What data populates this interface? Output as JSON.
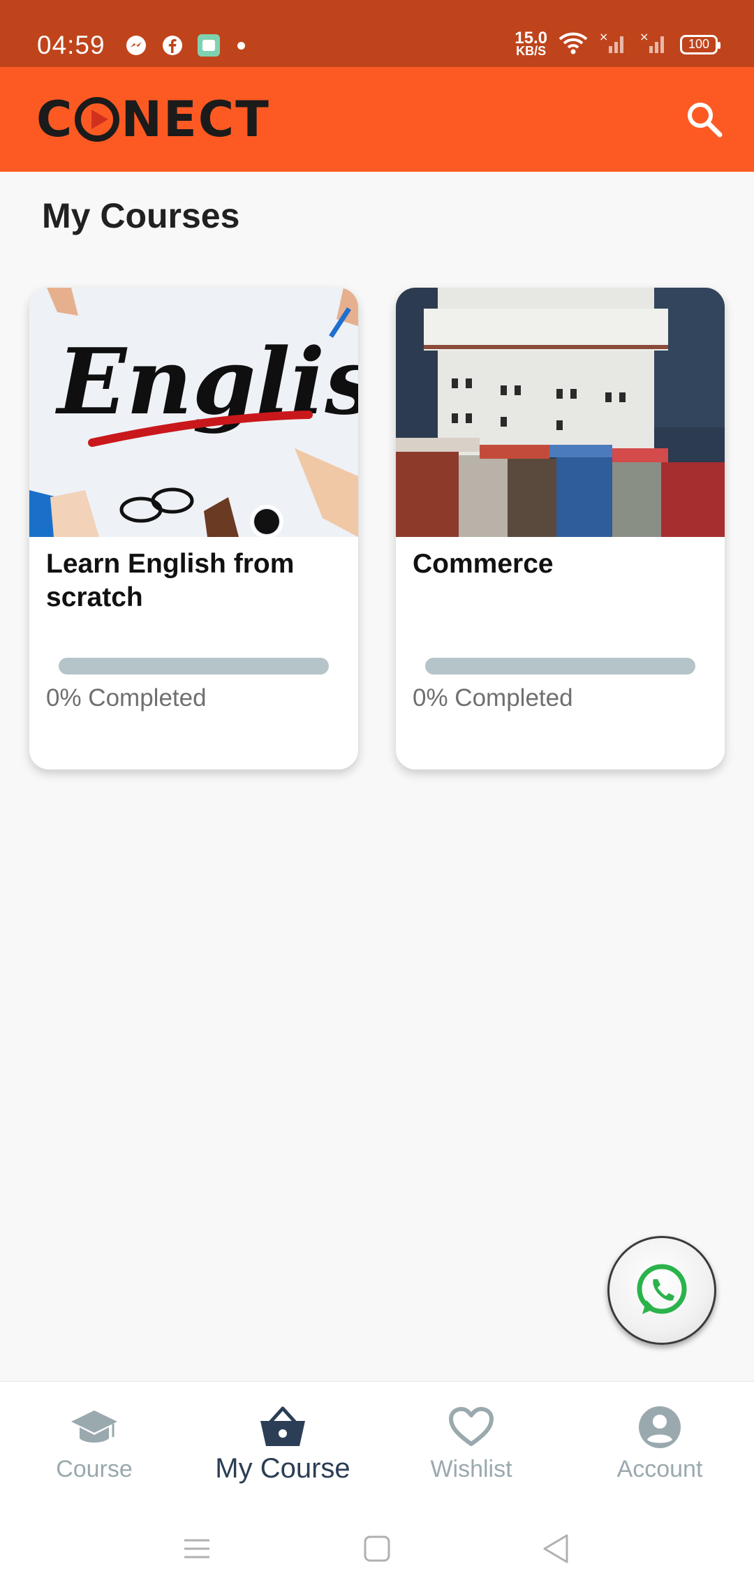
{
  "status_bar": {
    "time": "04:59",
    "net_speed_value": "15.0",
    "net_speed_unit": "KB/S",
    "battery": "100",
    "icons": [
      "messenger-icon",
      "facebook-icon",
      "app-icon",
      "wifi-icon",
      "signal-icon",
      "signal-icon",
      "battery-icon"
    ]
  },
  "app_bar": {
    "logo_parts": [
      "C",
      "NECT"
    ],
    "search_icon": "search-icon"
  },
  "page": {
    "title": "My Courses"
  },
  "courses": [
    {
      "title": "Learn English from scratch",
      "progress": 0,
      "progress_label": "0% Completed"
    },
    {
      "title": "Commerce",
      "progress": 0,
      "progress_label": "0% Completed"
    }
  ],
  "fab": {
    "icon": "whatsapp-icon"
  },
  "bottom_nav": {
    "items": [
      {
        "label": "Course",
        "icon": "graduation-cap-icon"
      },
      {
        "label": "My Course",
        "icon": "basket-icon",
        "active": true
      },
      {
        "label": "Wishlist",
        "icon": "heart-icon"
      },
      {
        "label": "Account",
        "icon": "account-icon"
      }
    ]
  },
  "colors": {
    "status_bar": "#bf441c",
    "app_bar": "#fd5a23",
    "nav_active": "#2c3e55",
    "nav_inactive": "#9aa9ae",
    "progress_track": "#b5c4c9"
  }
}
